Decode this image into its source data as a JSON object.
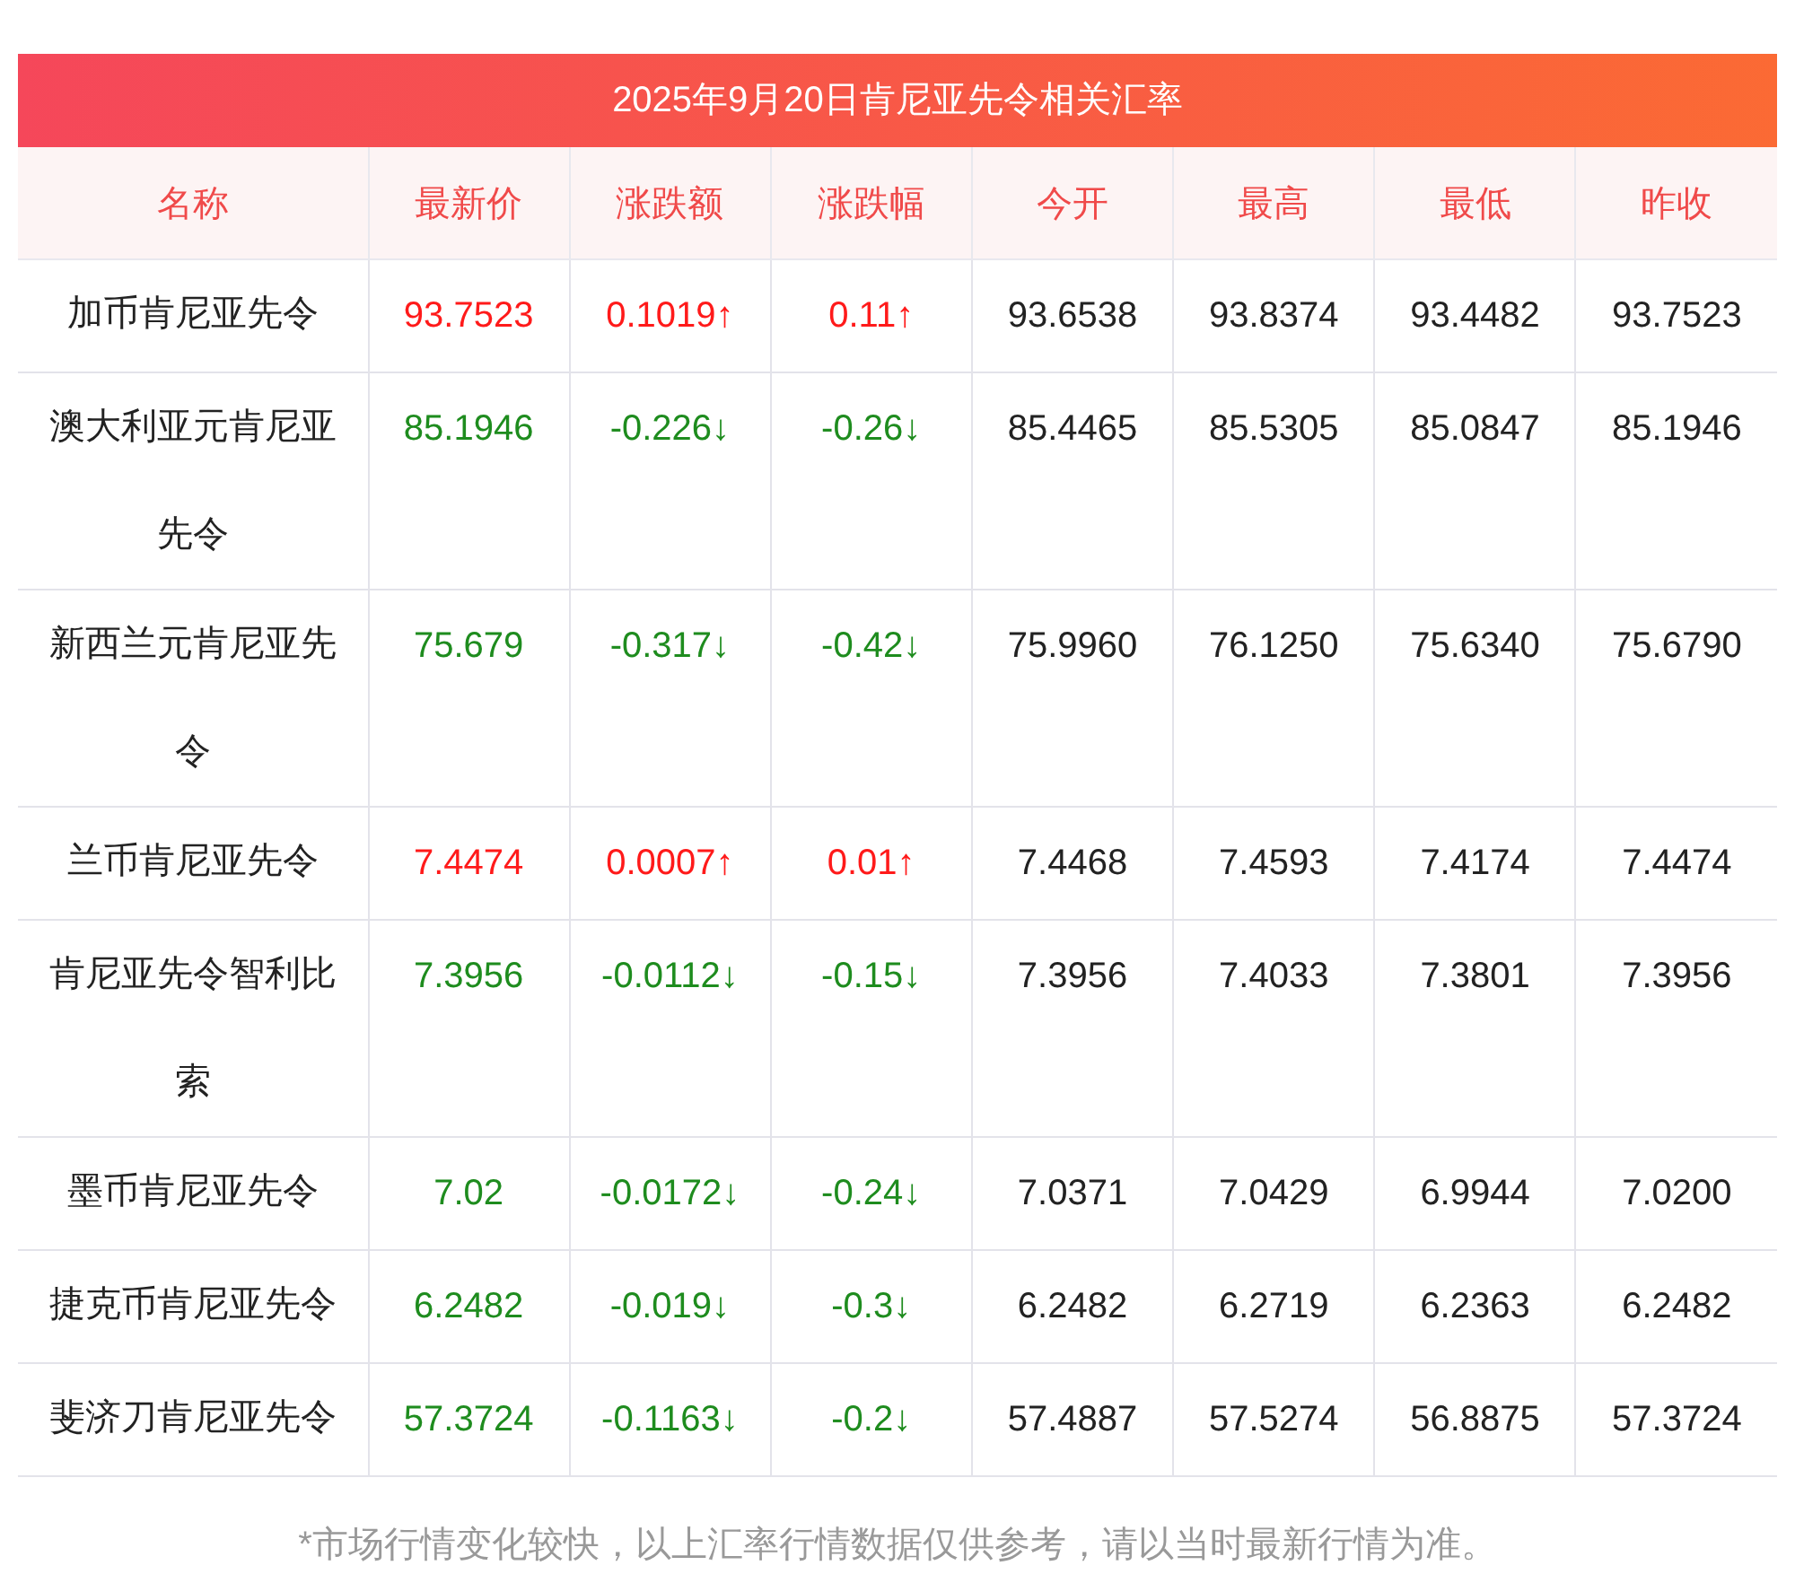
{
  "title": "2025年9月20日肯尼亚先令相关汇率",
  "columns": [
    "名称",
    "最新价",
    "涨跌额",
    "涨跌幅",
    "今开",
    "最高",
    "最低",
    "昨收"
  ],
  "rows": [
    {
      "name": "加币肯尼亚先令",
      "color": "#ff1a1a",
      "latest": "93.7523",
      "change": "0.1019↑",
      "change_pct": "0.11↑",
      "open": "93.6538",
      "high": "93.8374",
      "low": "93.4482",
      "prev_close": "93.7523"
    },
    {
      "name": "澳大利亚元肯尼亚先令",
      "color": "#1e8c1e",
      "latest": "85.1946",
      "change": "-0.226↓",
      "change_pct": "-0.26↓",
      "open": "85.4465",
      "high": "85.5305",
      "low": "85.0847",
      "prev_close": "85.1946"
    },
    {
      "name": "新西兰元肯尼亚先令",
      "color": "#1e8c1e",
      "latest": "75.679",
      "change": "-0.317↓",
      "change_pct": "-0.42↓",
      "open": "75.9960",
      "high": "76.1250",
      "low": "75.6340",
      "prev_close": "75.6790"
    },
    {
      "name": "兰币肯尼亚先令",
      "color": "#ff1a1a",
      "latest": "7.4474",
      "change": "0.0007↑",
      "change_pct": "0.01↑",
      "open": "7.4468",
      "high": "7.4593",
      "low": "7.4174",
      "prev_close": "7.4474"
    },
    {
      "name": "肯尼亚先令智利比索",
      "color": "#1e8c1e",
      "latest": "7.3956",
      "change": "-0.0112↓",
      "change_pct": "-0.15↓",
      "open": "7.3956",
      "high": "7.4033",
      "low": "7.3801",
      "prev_close": "7.3956"
    },
    {
      "name": "墨币肯尼亚先令",
      "color": "#1e8c1e",
      "latest": "7.02",
      "change": "-0.0172↓",
      "change_pct": "-0.24↓",
      "open": "7.0371",
      "high": "7.0429",
      "low": "6.9944",
      "prev_close": "7.0200"
    },
    {
      "name": "捷克币肯尼亚先令",
      "color": "#1e8c1e",
      "latest": "6.2482",
      "change": "-0.019↓",
      "change_pct": "-0.3↓",
      "open": "6.2482",
      "high": "6.2719",
      "low": "6.2363",
      "prev_close": "6.2482"
    },
    {
      "name": "斐济刀肯尼亚先令",
      "color": "#1e8c1e",
      "latest": "57.3724",
      "change": "-0.1163↓",
      "change_pct": "-0.2↓",
      "open": "57.4887",
      "high": "57.5274",
      "low": "56.8875",
      "prev_close": "57.3724"
    }
  ],
  "footnote": "*市场行情变化较快，以上汇率行情数据仅供参考，请以当时最新行情为准。"
}
